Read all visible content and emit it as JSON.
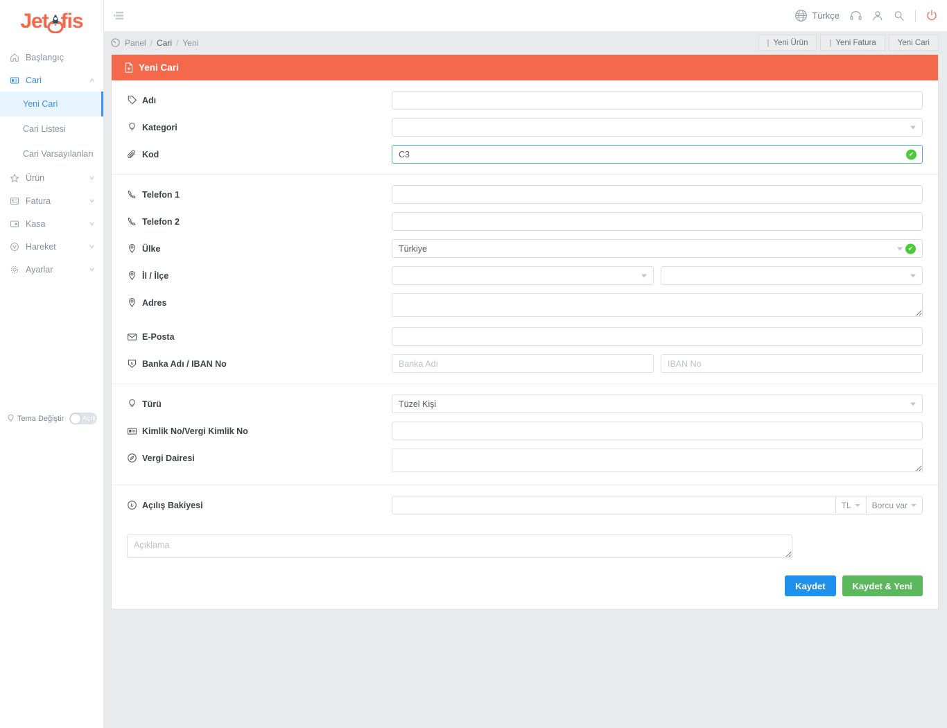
{
  "brand": {
    "name_left": "Jet",
    "name_right": "fis",
    "logo_icon": "rocket-icon"
  },
  "sidebar": {
    "items": [
      {
        "label": "Başlangıç",
        "icon": "home-icon",
        "has_caret": false,
        "active": false
      },
      {
        "label": "Cari",
        "icon": "id-card-icon",
        "has_caret": true,
        "caret": "˄",
        "active": true
      },
      {
        "label": "Ürün",
        "icon": "star-icon",
        "has_caret": true,
        "caret": "˅",
        "active": false
      },
      {
        "label": "Fatura",
        "icon": "invoice-icon",
        "has_caret": true,
        "caret": "˅",
        "active": false
      },
      {
        "label": "Kasa",
        "icon": "cash-box-icon",
        "has_caret": true,
        "caret": "˅",
        "active": false
      },
      {
        "label": "Hareket",
        "icon": "movement-icon",
        "has_caret": true,
        "caret": "˅",
        "active": false
      },
      {
        "label": "Ayarlar",
        "icon": "gear-icon",
        "has_caret": true,
        "caret": "˅",
        "active": false
      }
    ],
    "sub_items": [
      {
        "label": "Yeni Cari",
        "selected": true
      },
      {
        "label": "Cari Listesi",
        "selected": false
      },
      {
        "label": "Cari Varsayılanları",
        "selected": false
      }
    ],
    "theme": {
      "label": "Tema Değiştir",
      "toggle_state": "Açık",
      "icon": "bulb-icon"
    }
  },
  "topbar": {
    "collapse_icon": "collapse-sidebar-icon",
    "language": "Türkçe",
    "language_icon": "globe-icon",
    "icons": [
      "headset-icon",
      "user-icon",
      "search-icon"
    ],
    "power_icon": "power-icon"
  },
  "breadcrumb": {
    "home_icon": "dashboard-icon",
    "items": [
      "Panel",
      "Cari",
      "Yeni"
    ],
    "separator": "/"
  },
  "quick_actions": [
    {
      "label": "Yeni Ürün",
      "mini_icon": "bar-icon"
    },
    {
      "label": "Yeni Fatura",
      "mini_icon": "bar-icon"
    },
    {
      "label": "Yeni Cari",
      "mini_icon": ""
    }
  ],
  "card": {
    "title": "Yeni Cari",
    "title_icon": "file-add-icon",
    "accent_color": "#f4694c"
  },
  "form": {
    "section1": [
      {
        "label": "Adı",
        "icon": "tag-icon",
        "type": "text",
        "value": "",
        "placeholder": "",
        "valid": false
      },
      {
        "label": "Kategori",
        "icon": "bulb-icon",
        "type": "select",
        "value": "",
        "placeholder": "",
        "valid": false
      },
      {
        "label": "Kod",
        "icon": "paperclip-icon",
        "type": "text",
        "value": "C3",
        "placeholder": "",
        "valid": true,
        "focused": true
      }
    ],
    "section2": [
      {
        "label": "Telefon 1",
        "icon": "phone-icon",
        "type": "text",
        "value": "",
        "placeholder": "",
        "valid": false
      },
      {
        "label": "Telefon 2",
        "icon": "phone-icon",
        "type": "text",
        "value": "",
        "placeholder": "",
        "valid": false
      },
      {
        "label": "Ülke",
        "icon": "pin-icon",
        "type": "select",
        "value": "Türkiye",
        "placeholder": "",
        "valid": true
      },
      {
        "label": "İl / İlçe",
        "icon": "pin-icon",
        "type": "select-pair",
        "value": "",
        "value2": "",
        "valid": false
      },
      {
        "label": "Adres",
        "icon": "pin-icon",
        "type": "textarea",
        "value": "",
        "placeholder": "",
        "valid": false
      },
      {
        "label": "E-Posta",
        "icon": "envelope-icon",
        "type": "text",
        "value": "",
        "placeholder": "",
        "valid": false
      },
      {
        "label": "Banka Adı / IBAN No",
        "icon": "bank-icon",
        "type": "text-pair",
        "value": "",
        "placeholder": "Banka Adı",
        "value2": "",
        "placeholder2": "IBAN No",
        "valid": false
      }
    ],
    "section3": [
      {
        "label": "Türü",
        "icon": "bulb-icon",
        "type": "select",
        "value": "Tüzel Kişi",
        "placeholder": "",
        "valid": false
      },
      {
        "label": "Kimlik No/Vergi Kimlik No",
        "icon": "id-card-icon",
        "type": "text",
        "value": "",
        "placeholder": "",
        "valid": false
      },
      {
        "label": "Vergi Dairesi",
        "icon": "compass-icon",
        "type": "textarea",
        "value": "",
        "placeholder": "",
        "valid": false
      }
    ],
    "section4": [
      {
        "label": "Açılış Bakiyesi",
        "icon": "coin-icon",
        "type": "input-group",
        "value": "",
        "placeholder": "",
        "addons": [
          "TL",
          "Borcu var"
        ]
      }
    ],
    "description": {
      "value": "",
      "placeholder": "Açıklama"
    }
  },
  "footer_actions": [
    {
      "label": "Kaydet",
      "style": "primary",
      "color": "#1f90ec"
    },
    {
      "label": "Kaydet & Yeni",
      "style": "success",
      "color": "#5cb85c"
    }
  ]
}
